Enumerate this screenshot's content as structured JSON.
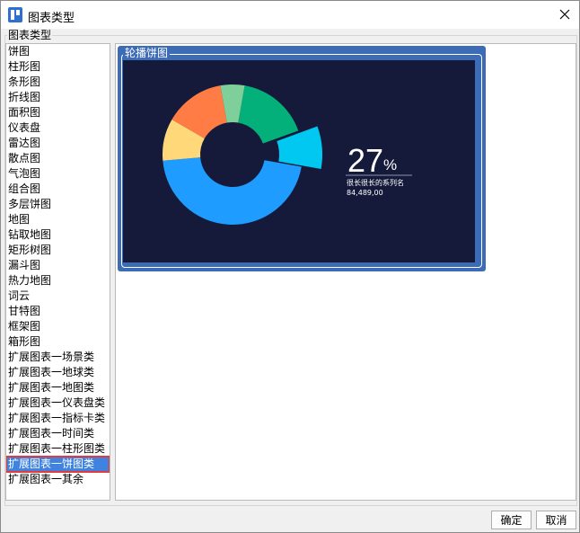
{
  "window": {
    "title": "图表类型"
  },
  "group": {
    "label": "图表类型"
  },
  "chart_types": [
    "饼图",
    "柱形图",
    "条形图",
    "折线图",
    "面积图",
    "仪表盘",
    "雷达图",
    "散点图",
    "气泡图",
    "组合图",
    "多层饼图",
    "地图",
    "钻取地图",
    "矩形树图",
    "漏斗图",
    "热力地图",
    "词云",
    "甘特图",
    "框架图",
    "箱形图",
    "扩展图表一场景类",
    "扩展图表一地球类",
    "扩展图表一地图类",
    "扩展图表一仪表盘类",
    "扩展图表一指标卡类",
    "扩展图表一时间类",
    "扩展图表一柱形图类",
    "扩展图表一饼图类",
    "扩展图表一其余"
  ],
  "selected_index": 27,
  "preview": {
    "label": "轮播饼图",
    "percent_value": "27",
    "percent_sign": "%",
    "series_name": "很长很长的系列名",
    "series_value": "84,489,00"
  },
  "colors": {
    "canvas_bg": "#151a3a",
    "selection_bg": "#3f82df",
    "selection_outline": "#e23b3b",
    "thumb_frame": "#3c6cb6"
  },
  "buttons": {
    "ok": "确定",
    "cancel": "取消"
  }
}
